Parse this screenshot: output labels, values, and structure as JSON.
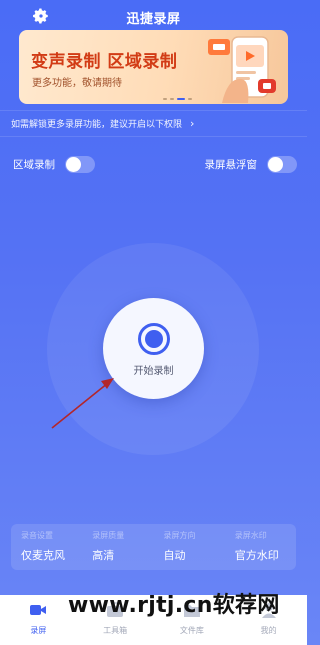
{
  "app": {
    "title": "迅捷录屏"
  },
  "banner": {
    "title": "变声录制  区域录制",
    "subtitle": "更多功能，敬请期待"
  },
  "notice": {
    "text": "如需解锁更多录屏功能，建议开启以下权限",
    "chevron": "›"
  },
  "toggles": {
    "region_record": {
      "label": "区域录制",
      "on": false
    },
    "floating_window": {
      "label": "录屏悬浮窗",
      "on": false
    }
  },
  "record_button": {
    "label": "开始录制"
  },
  "settings": [
    {
      "key": "录音设置",
      "value": "仅麦克风"
    },
    {
      "key": "录屏质量",
      "value": "高清"
    },
    {
      "key": "录屏方向",
      "value": "自动"
    },
    {
      "key": "录屏水印",
      "value": "官方水印"
    }
  ],
  "tabs": [
    {
      "label": "录屏",
      "icon": "video-camera-icon",
      "active": true
    },
    {
      "label": "工具箱",
      "icon": "toolbox-icon",
      "active": false
    },
    {
      "label": "文件库",
      "icon": "folder-icon",
      "active": false
    },
    {
      "label": "我的",
      "icon": "person-icon",
      "active": false
    }
  ],
  "watermark": {
    "text": "www.rjtj.cn软荐网"
  },
  "colors": {
    "primary": "#3f5ff0",
    "background_top": "#4a6cf6",
    "banner_title": "#d23b15",
    "arrow": "#b3262b"
  }
}
